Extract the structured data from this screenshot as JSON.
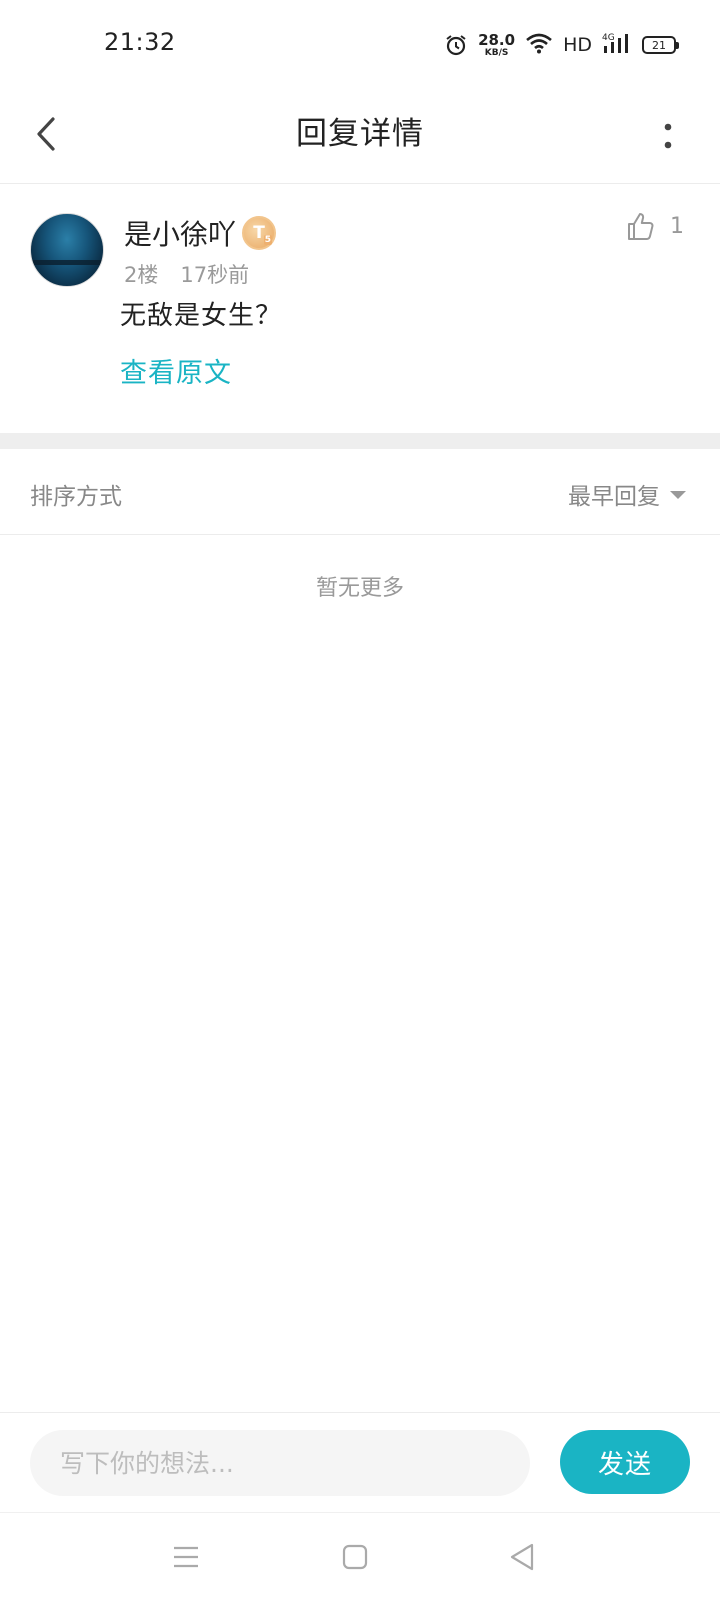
{
  "status_bar": {
    "time": "21:32",
    "net_speed_value": "28.0",
    "net_speed_unit": "KB/S",
    "hd": "HD",
    "network": "4G",
    "battery": "21",
    "icons": [
      "alarm-icon",
      "wifi-icon",
      "signal-icon",
      "battery-icon"
    ]
  },
  "header": {
    "title": "回复详情",
    "back_icon": "chevron-left-icon",
    "more_icon": "more-vertical-icon"
  },
  "reply": {
    "username": "是小徐吖",
    "level_badge": "T",
    "level_sub": "5",
    "floor": "2楼",
    "time_ago": "17秒前",
    "content": "无敌是女生？",
    "view_original": "查看原文",
    "like_count": "1",
    "like_icon": "thumbs-up-icon"
  },
  "sort": {
    "label": "排序方式",
    "selected": "最早回复"
  },
  "empty_text": "暂无更多",
  "composer": {
    "placeholder": "写下你的想法...",
    "send_label": "发送"
  },
  "colors": {
    "accent": "#1ab4c4",
    "muted_text": "#999999",
    "divider": "#eeeeee"
  }
}
